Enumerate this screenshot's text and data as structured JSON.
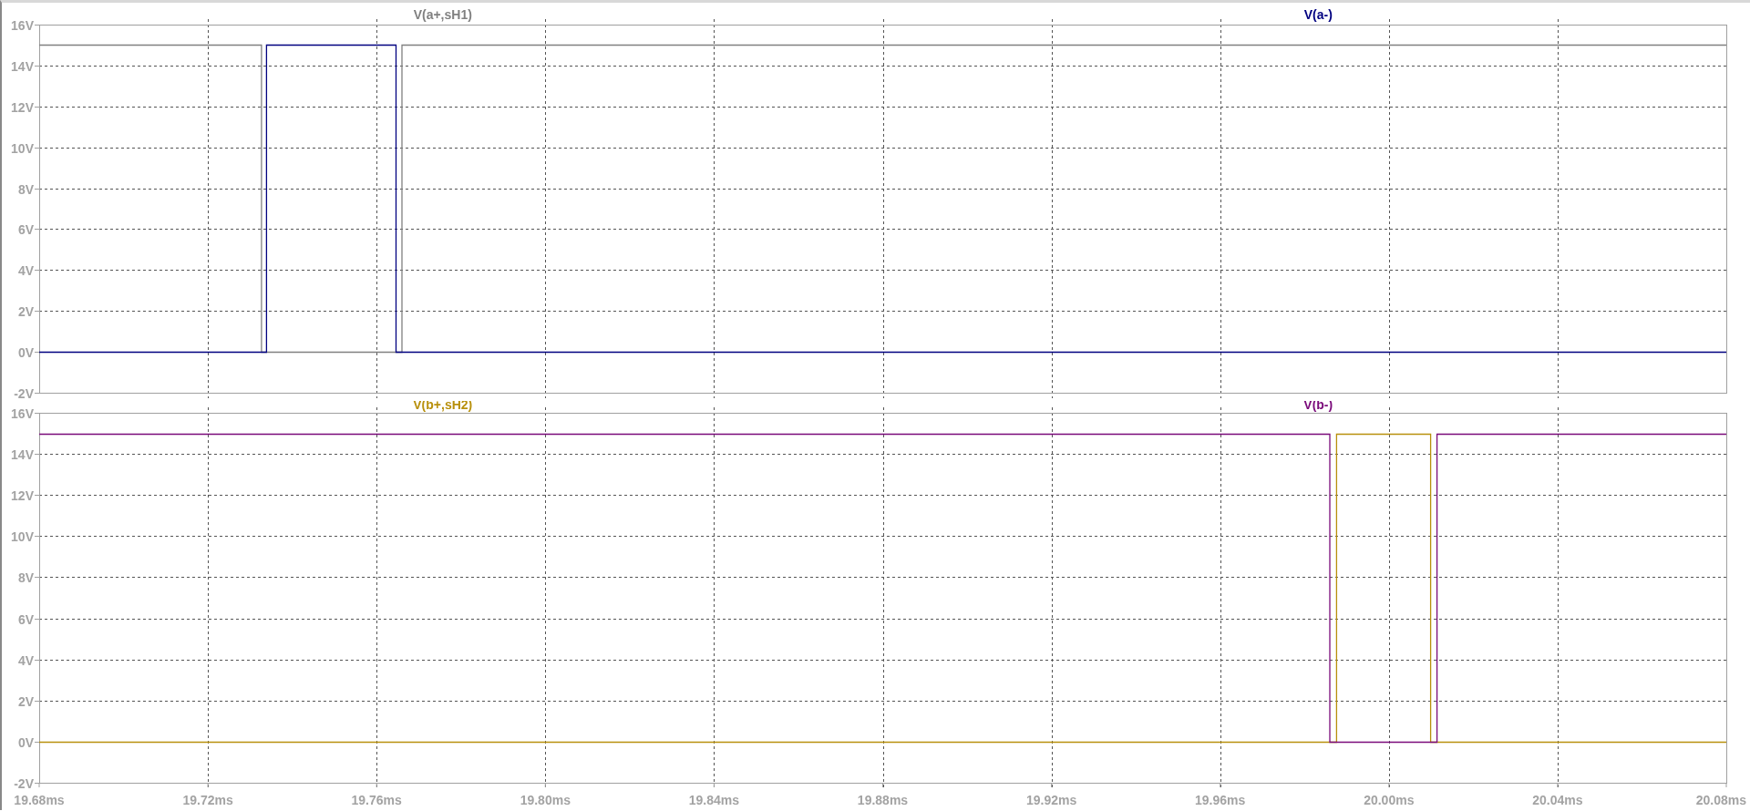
{
  "panes": [
    {
      "chart_data": {
        "type": "line",
        "x": [
          19.68,
          19.7327,
          19.7327,
          19.7339,
          19.7339,
          19.7646,
          19.7646,
          19.766,
          19.766,
          20.08
        ],
        "series": [
          {
            "name": "V(a+,sH1)",
            "color": "#808080",
            "values": [
              15,
              15,
              0,
              0,
              0,
              0,
              0,
              0,
              15,
              15
            ]
          },
          {
            "name": "V(a-)",
            "color": "#000080",
            "values": [
              0,
              0,
              0,
              0,
              15,
              15,
              0,
              0,
              0,
              0
            ]
          }
        ],
        "xlim": [
          19.68,
          20.08
        ],
        "ylim": [
          -2,
          16
        ],
        "grid": true,
        "yticks": [
          {
            "value": 16,
            "label": "16V"
          },
          {
            "value": 14,
            "label": "14V"
          },
          {
            "value": 12,
            "label": "12V"
          },
          {
            "value": 10,
            "label": "10V"
          },
          {
            "value": 8,
            "label": "8V"
          },
          {
            "value": 6,
            "label": "6V"
          },
          {
            "value": 4,
            "label": "4V"
          },
          {
            "value": 2,
            "label": "2V"
          },
          {
            "value": 0,
            "label": "0V"
          },
          {
            "value": -2,
            "label": "-2V"
          }
        ]
      }
    },
    {
      "chart_data": {
        "type": "line",
        "x": [
          19.68,
          19.986,
          19.986,
          19.9876,
          19.9876,
          20.0099,
          20.0099,
          20.0114,
          20.0114,
          20.08
        ],
        "series": [
          {
            "name": "V(b+,sH2)",
            "color": "#b8900c",
            "values": [
              0,
              0,
              0,
              0,
              15,
              15,
              0,
              0,
              0,
              0
            ]
          },
          {
            "name": "V(b-)",
            "color": "#7a0a7a",
            "values": [
              15,
              15,
              0,
              0,
              0,
              0,
              0,
              0,
              15,
              15
            ]
          }
        ],
        "xlim": [
          19.68,
          20.08
        ],
        "ylim": [
          -2,
          16
        ],
        "grid": true,
        "xticks": [
          {
            "value": 19.68,
            "label": "19.68ms"
          },
          {
            "value": 19.72,
            "label": "19.72ms"
          },
          {
            "value": 19.76,
            "label": "19.76ms"
          },
          {
            "value": 19.8,
            "label": "19.80ms"
          },
          {
            "value": 19.84,
            "label": "19.84ms"
          },
          {
            "value": 19.88,
            "label": "19.88ms"
          },
          {
            "value": 19.92,
            "label": "19.92ms"
          },
          {
            "value": 19.96,
            "label": "19.96ms"
          },
          {
            "value": 20.0,
            "label": "20.00ms"
          },
          {
            "value": 20.04,
            "label": "20.04ms"
          },
          {
            "value": 20.08,
            "label": "20.08ms"
          }
        ],
        "yticks": [
          {
            "value": 16,
            "label": "16V"
          },
          {
            "value": 14,
            "label": "14V"
          },
          {
            "value": 12,
            "label": "12V"
          },
          {
            "value": 10,
            "label": "10V"
          },
          {
            "value": 8,
            "label": "8V"
          },
          {
            "value": 6,
            "label": "6V"
          },
          {
            "value": 4,
            "label": "4V"
          },
          {
            "value": 2,
            "label": "2V"
          },
          {
            "value": 0,
            "label": "0V"
          },
          {
            "value": -2,
            "label": "-2V"
          }
        ]
      }
    }
  ]
}
